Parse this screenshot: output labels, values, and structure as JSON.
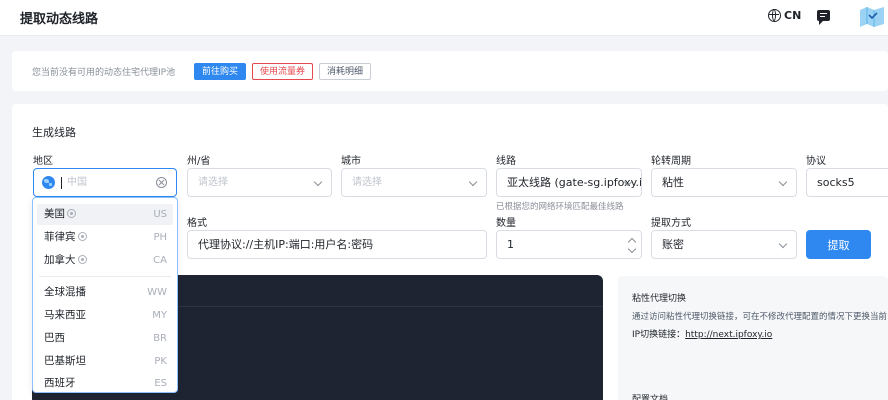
{
  "header": {
    "title": "提取动态线路",
    "lang": "CN",
    "icons": [
      "globe-icon",
      "message-icon",
      "map-icon"
    ]
  },
  "notice": {
    "text": "您当前没有可用的动态住宅代理IP池",
    "buy_label": "前往购买",
    "coupon_label": "使用流量券",
    "detail_label": "消耗明细"
  },
  "form": {
    "section_title": "生成线路",
    "region": {
      "label": "地区",
      "placeholder": "中国"
    },
    "state": {
      "label": "州/省",
      "placeholder": "请选择"
    },
    "city": {
      "label": "城市",
      "placeholder": "请选择"
    },
    "route": {
      "label": "线路",
      "value": "亚太线路 (gate-sg.ipfoxy.io)",
      "hint": "已根据您的网络环境匹配最佳线路"
    },
    "rotation": {
      "label": "轮转周期",
      "value": "粘性"
    },
    "protocol": {
      "label": "协议",
      "value": "socks5"
    },
    "format": {
      "label": "格式",
      "value": "代理协议://主机IP:端口:用户名:密码"
    },
    "quantity": {
      "label": "数量",
      "value": "1"
    },
    "extract_method": {
      "label": "提取方式",
      "value": "账密"
    },
    "submit_label": "提取"
  },
  "side_panel": {
    "title": "粘性代理切换",
    "desc": "通过访问粘性代理切换链接，可在不修改代理配置的情况下更换当前",
    "link_label": "IP切换链接：",
    "link": "http://next.ipfoxy.io",
    "title2": "配置文档"
  },
  "dropdown": {
    "items": [
      {
        "name": "美国",
        "code": "US",
        "badge": true
      },
      {
        "name": "菲律宾",
        "code": "PH",
        "badge": true
      },
      {
        "name": "加拿大",
        "code": "CA",
        "badge": true
      },
      {
        "name": "全球混播",
        "code": "WW",
        "badge": false
      },
      {
        "name": "马来西亚",
        "code": "MY",
        "badge": false
      },
      {
        "name": "巴西",
        "code": "BR",
        "badge": false
      },
      {
        "name": "巴基斯坦",
        "code": "PK",
        "badge": false
      },
      {
        "name": "西班牙",
        "code": "ES",
        "badge": false
      }
    ],
    "active_index": 0
  },
  "colors": {
    "accent": "#2f88f0",
    "danger": "#e5484d",
    "terminal_bg": "#1e2432"
  }
}
